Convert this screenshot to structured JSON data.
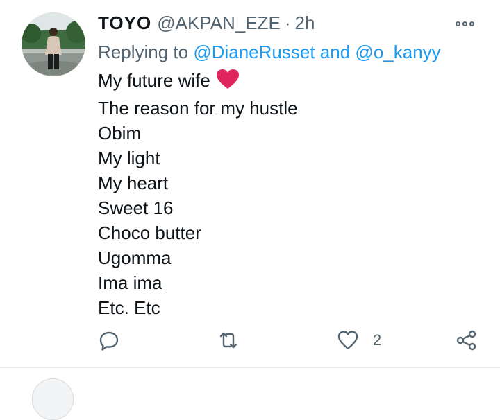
{
  "tweet": {
    "display_name": "TOYO",
    "handle": "@AKPAN_EZE",
    "separator": "·",
    "time": "2h",
    "replying_prefix": "Replying to",
    "reply_user_1": "@DianeRusset",
    "reply_and": "and",
    "reply_user_2": "@o_kanyy",
    "lines": [
      "My future wife",
      "The reason for my hustle",
      "Obim",
      "My light",
      "My heart",
      "Sweet 16",
      "Choco butter",
      "Ugomma",
      "Ima ima",
      "Etc. Etc"
    ],
    "emoji": "red-heart-emoji",
    "like_count": "2"
  },
  "colors": {
    "text": "#0f1419",
    "secondary": "#536471",
    "link": "#1d9bf0",
    "heart_emoji": "#e0245e"
  },
  "icons": [
    "more-options-icon",
    "reply-icon",
    "retweet-icon",
    "like-icon",
    "share-icon"
  ]
}
